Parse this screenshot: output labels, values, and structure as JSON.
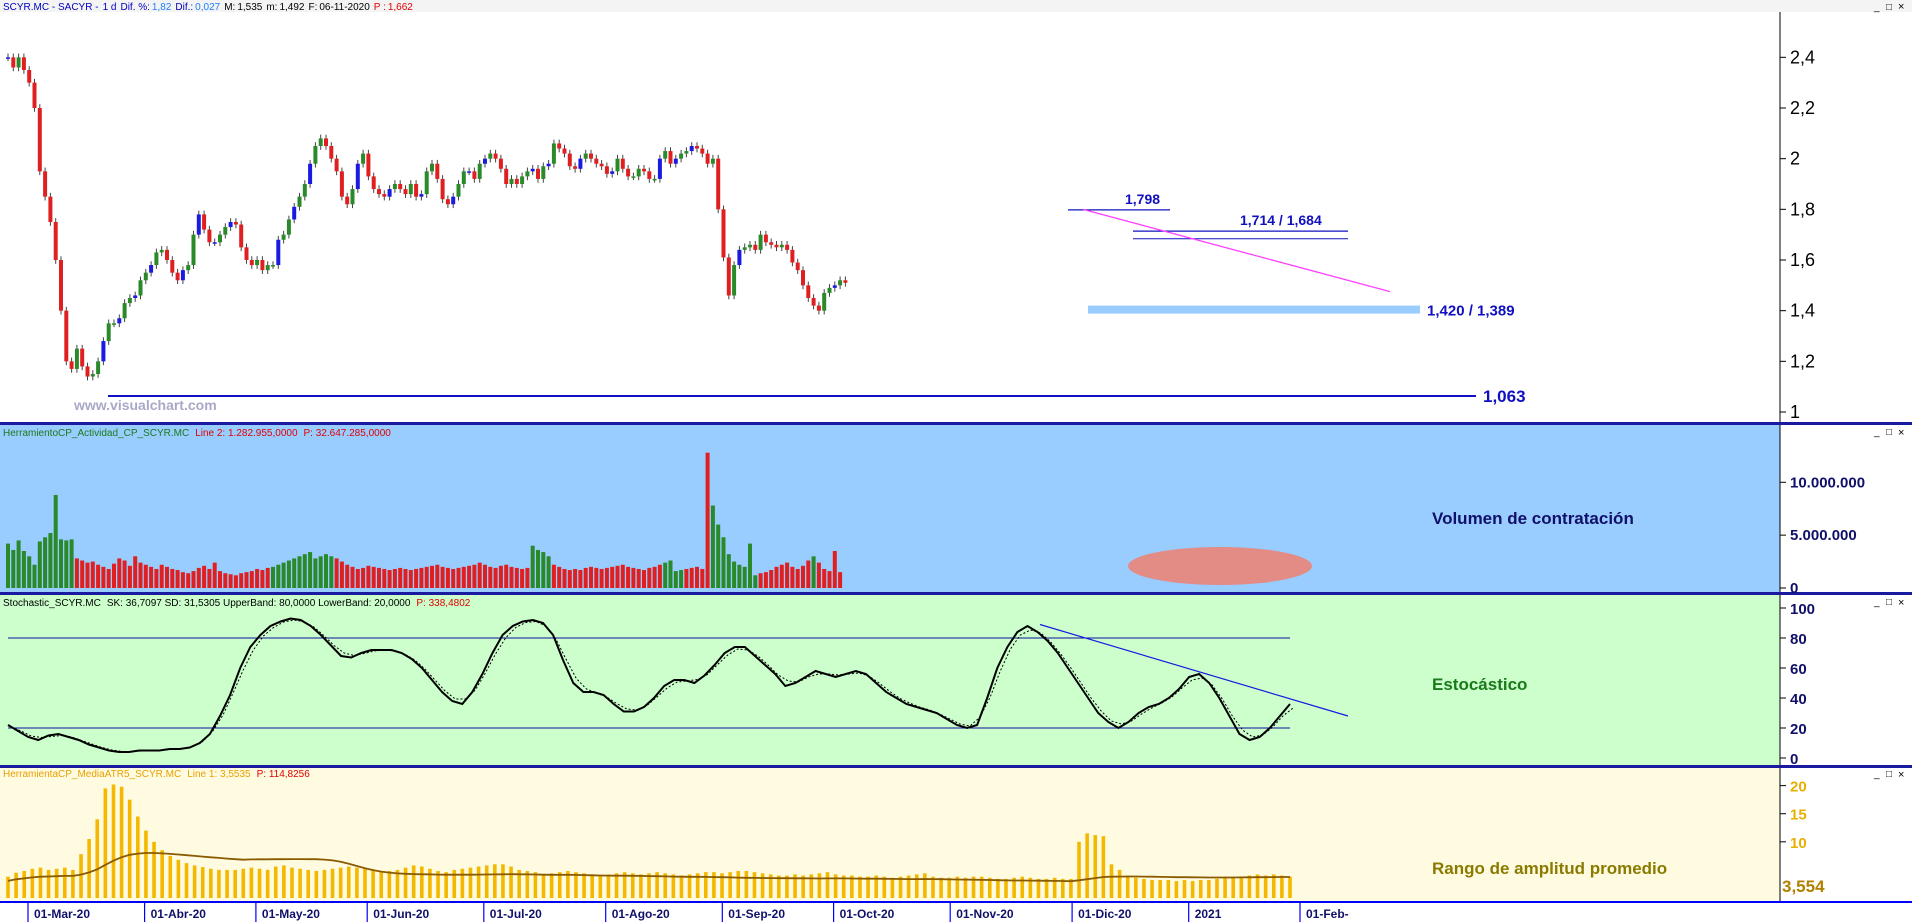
{
  "header": {
    "symbol": "SCYR.MC - SACYR -",
    "timeframe": "1 d",
    "dif_pct_label": "Dif. %:",
    "dif_pct": "1,82",
    "dif_label": "Dif.:",
    "dif": "0,027",
    "max_label": "M:",
    "max": "1,535",
    "min_label": "m:",
    "min": "1,492",
    "date_label": "F:",
    "date": "06-11-2020",
    "price_label": "P :",
    "price": "1,662"
  },
  "watermark": "www.visualchart.com",
  "window_controls": [
    "_",
    "□",
    "×"
  ],
  "colors": {
    "bull_candle": "#2a8a2a",
    "bear_candle": "#e02020",
    "blue_candle": "#1a1ae0",
    "volume_bg": "#99ccff",
    "stoch_bg": "#ccffcc",
    "atr_bg": "#fffbe0",
    "atr_bar": "#f5b800",
    "level_line": "#1010c0",
    "trend_magenta": "#ff40ff",
    "support_zone": "#99ccff"
  },
  "chart_data": [
    {
      "type": "candlestick",
      "title": "SCYR.MC - SACYR - 1 d",
      "ylim": [
        1.0,
        2.5
      ],
      "yticks": [
        "2,4",
        "2,2",
        "2",
        "1,8",
        "1,6",
        "1,4",
        "1,2",
        "1"
      ],
      "yticks_values": [
        2.4,
        2.2,
        2.0,
        1.8,
        1.6,
        1.4,
        1.2,
        1.0
      ],
      "x_tick_labels": [
        "01-Mar-20",
        "01-Abr-20",
        "01-May-20",
        "01-Jun-20",
        "01-Jul-20",
        "01-Ago-20",
        "01-Sep-20",
        "01-Oct-20",
        "01-Nov-20",
        "01-Dic-20",
        "2021",
        "01-Feb-"
      ],
      "x_tick_index": [
        0,
        22,
        43,
        64,
        86,
        109,
        131,
        152,
        174,
        197,
        219,
        240
      ],
      "close_approx": [
        2.4,
        2.36,
        2.4,
        2.35,
        2.3,
        2.2,
        1.95,
        1.85,
        1.75,
        1.6,
        1.4,
        1.2,
        1.17,
        1.25,
        1.18,
        1.14,
        1.15,
        1.2,
        1.28,
        1.35,
        1.35,
        1.37,
        1.43,
        1.45,
        1.46,
        1.52,
        1.55,
        1.58,
        1.63,
        1.64,
        1.6,
        1.55,
        1.52,
        1.56,
        1.58,
        1.7,
        1.78,
        1.72,
        1.67,
        1.67,
        1.7,
        1.73,
        1.75,
        1.74,
        1.65,
        1.6,
        1.58,
        1.6,
        1.56,
        1.58,
        1.58,
        1.68,
        1.7,
        1.76,
        1.81,
        1.85,
        1.9,
        1.98,
        2.05,
        2.08,
        2.05,
        2.0,
        1.95,
        1.85,
        1.82,
        1.88,
        1.98,
        2.02,
        1.93,
        1.88,
        1.86,
        1.85,
        1.88,
        1.9,
        1.88,
        1.86,
        1.9,
        1.85,
        1.86,
        1.95,
        1.98,
        1.92,
        1.84,
        1.82,
        1.85,
        1.9,
        1.95,
        1.95,
        1.92,
        1.98,
        2.0,
        2.02,
        2.0,
        1.96,
        1.9,
        1.92,
        1.9,
        1.93,
        1.95,
        1.96,
        1.92,
        1.97,
        1.98,
        2.06,
        2.04,
        2.02,
        1.97,
        1.96,
        2.0,
        2.02,
        2.0,
        1.98,
        1.97,
        1.94,
        1.95,
        2.0,
        1.96,
        1.93,
        1.93,
        1.96,
        1.95,
        1.92,
        1.92,
        2.0,
        2.03,
        1.98,
        2.0,
        2.02,
        2.03,
        2.05,
        2.04,
        2.02,
        1.98,
        2.0
      ],
      "gap_start_index": 132,
      "close_after_gap": [
        1.8,
        1.61,
        1.46,
        1.58,
        1.64,
        1.65,
        1.66,
        1.64,
        1.7,
        1.67,
        1.66,
        1.65,
        1.66,
        1.64,
        1.59,
        1.56,
        1.5,
        1.45,
        1.42,
        1.4,
        1.47,
        1.49,
        1.5,
        1.52,
        1.51
      ],
      "annotations": [
        {
          "label": "1,798",
          "value": 1.798
        },
        {
          "label": "1,714 / 1,684",
          "value": 1.714
        },
        {
          "label": "1,420 / 1,389",
          "value": 1.42
        },
        {
          "label": "1,063",
          "value": 1.063
        }
      ]
    },
    {
      "type": "bar",
      "name": "HerramientoCP_Actividad_CP_SCYR.MC",
      "legend_text": "Line 2: 1.282.955,0000",
      "legend_price": "P: 32.647.285,0000",
      "label": "Volumen de contratación",
      "ylim": [
        0,
        14000000
      ],
      "yticks": [
        "10.000.000",
        "5.000.000",
        "0"
      ],
      "yticks_values": [
        10000000,
        5000000,
        0
      ],
      "volume_approx": [
        4.2,
        3.6,
        4.5,
        3.5,
        3.0,
        2.2,
        4.4,
        4.8,
        5.2,
        8.8,
        4.6,
        4.5,
        4.6,
        2.8,
        2.6,
        2.4,
        2.5,
        2.2,
        2.0,
        1.8,
        2.3,
        2.8,
        2.6,
        2.1,
        3.0,
        2.4,
        2.2,
        2.0,
        1.8,
        2.2,
        2.0,
        1.8,
        1.7,
        1.5,
        1.4,
        1.6,
        1.9,
        2.1,
        1.8,
        2.4,
        1.6,
        1.4,
        1.3,
        1.2,
        1.4,
        1.5,
        1.6,
        1.8,
        1.7,
        1.9,
        2.0,
        2.2,
        2.4,
        2.6,
        2.8,
        3.0,
        3.2,
        3.4,
        2.8,
        3.0,
        3.2,
        3.0,
        2.8,
        2.5,
        2.2,
        2.0,
        1.8,
        1.9,
        2.1,
        2.0,
        1.9,
        1.8,
        1.7,
        1.8,
        1.9,
        1.8,
        1.7,
        1.8,
        1.9,
        2.0,
        2.1,
        2.2,
        2.0,
        1.9,
        1.8,
        1.9,
        2.0,
        2.1,
        2.2,
        2.4,
        2.2,
        2.0,
        1.9,
        2.1,
        2.2,
        2.0,
        1.9,
        1.8,
        1.9,
        4.0,
        3.6,
        3.4,
        3.0,
        2.2,
        2.0,
        1.8,
        1.7,
        1.8,
        1.7,
        1.9,
        2.0,
        1.9,
        1.8,
        1.9,
        2.0,
        2.1,
        2.2,
        2.0,
        1.9,
        1.8,
        1.7,
        1.9,
        2.0,
        2.2,
        2.4,
        2.6,
        1.6,
        1.7,
        1.8,
        1.9,
        2.0,
        1.8,
        12.8,
        7.8,
        6.0,
        4.8,
        3.2,
        2.5,
        2.2,
        2.0,
        4.2,
        1.2,
        1.4,
        1.5,
        1.7,
        2.0,
        2.2,
        2.4,
        2.0,
        1.8,
        2.1,
        2.6,
        3.0,
        2.4,
        1.8,
        1.6,
        3.5,
        1.5
      ],
      "volume_units": "millions",
      "volume_up": [
        1,
        1,
        1,
        1,
        1,
        1,
        1,
        1,
        1,
        1,
        1,
        1,
        1,
        0,
        0,
        0,
        0,
        0,
        0,
        0,
        0,
        0,
        0,
        0,
        0,
        0,
        0,
        0,
        0,
        0,
        0,
        0,
        0,
        0,
        0,
        0,
        0,
        0,
        0,
        0,
        0,
        0,
        0,
        0,
        0,
        0,
        0,
        0,
        0,
        0,
        1,
        1,
        1,
        1,
        1,
        1,
        1,
        1,
        1,
        1,
        1,
        1,
        0,
        0,
        0,
        0,
        0,
        0,
        0,
        0,
        0,
        0,
        0,
        0,
        0,
        0,
        0,
        0,
        0,
        0,
        0,
        0,
        0,
        0,
        0,
        0,
        0,
        0,
        0,
        0,
        0,
        0,
        0,
        0,
        0,
        0,
        0,
        0,
        0,
        1,
        1,
        1,
        1,
        0,
        0,
        0,
        0,
        0,
        0,
        0,
        0,
        0,
        0,
        0,
        0,
        0,
        0,
        0,
        0,
        0,
        0,
        0,
        0,
        0,
        1,
        1,
        1,
        1,
        0,
        0,
        0,
        0,
        0,
        1,
        1,
        1,
        1,
        1,
        1,
        1,
        1,
        1,
        0,
        0,
        0,
        0,
        0,
        0,
        0,
        0,
        0,
        0,
        1,
        0,
        0,
        0,
        0,
        0
      ]
    },
    {
      "type": "line",
      "name": "Stochastic_SCYR.MC",
      "legend_text": "SK: 36,7097  SD: 31,5305  UpperBand: 80,0000  LowerBand: 20,0000",
      "legend_price": "P: 338,4802",
      "label": "Estocástico",
      "ylim": [
        0,
        100
      ],
      "yticks": [
        "100",
        "80",
        "60",
        "40",
        "20",
        "0"
      ],
      "yticks_values": [
        100,
        80,
        60,
        40,
        20,
        0
      ],
      "bands": [
        80,
        20
      ],
      "sk_approx": [
        22,
        18,
        14,
        12,
        15,
        16,
        14,
        12,
        9,
        7,
        5,
        4,
        4,
        5,
        5,
        5,
        6,
        6,
        7,
        10,
        16,
        28,
        42,
        60,
        74,
        82,
        88,
        91,
        93,
        92,
        88,
        82,
        75,
        68,
        67,
        70,
        72,
        72,
        72,
        70,
        66,
        60,
        52,
        44,
        38,
        36,
        44,
        56,
        70,
        82,
        88,
        91,
        92,
        90,
        82,
        65,
        50,
        44,
        44,
        42,
        36,
        31,
        31,
        34,
        40,
        48,
        52,
        52,
        50,
        55,
        62,
        70,
        74,
        74,
        68,
        62,
        56,
        48,
        50,
        54,
        58,
        56,
        54,
        56,
        58,
        56,
        50,
        44,
        40,
        36,
        34,
        32,
        30,
        26,
        22,
        20,
        22,
        40,
        60,
        74,
        84,
        88,
        84,
        78,
        70,
        60,
        50,
        40,
        30,
        24,
        20,
        24,
        30,
        34,
        36,
        40,
        46,
        54,
        56,
        50,
        40,
        28,
        16,
        12,
        14,
        20,
        28,
        36
      ]
    },
    {
      "type": "bar",
      "name": "HerramientaCP_MediaATR5_SCYR.MC",
      "legend_text": "Line 1: 3,5535",
      "legend_price": "P: 114,8256",
      "label": "Rango de amplitud promedio",
      "last_value_label": "3,554",
      "ylim": [
        0,
        21
      ],
      "yticks": [
        "20",
        "15",
        "10"
      ],
      "yticks_values": [
        20,
        15,
        10
      ],
      "atr_approx": [
        3.8,
        4.5,
        4.8,
        5.2,
        5.4,
        5.0,
        5.2,
        5.4,
        5.0,
        7.8,
        10.5,
        14.0,
        19.5,
        20.2,
        19.8,
        17.5,
        14.5,
        12.0,
        10.0,
        8.5,
        7.5,
        6.8,
        6.2,
        5.8,
        5.5,
        5.2,
        5.0,
        5.0,
        5.0,
        5.2,
        5.4,
        5.2,
        5.0,
        5.6,
        5.8,
        5.4,
        5.2,
        5.0,
        4.8,
        5.0,
        5.2,
        5.4,
        5.6,
        5.4,
        5.2,
        5.0,
        4.6,
        4.8,
        5.0,
        5.4,
        5.8,
        5.6,
        5.2,
        4.8,
        4.6,
        5.0,
        5.2,
        5.4,
        5.6,
        5.8,
        6.0,
        6.0,
        5.6,
        5.0,
        4.8,
        4.6,
        4.2,
        4.4,
        4.6,
        4.8,
        4.6,
        4.4,
        4.2,
        4.0,
        4.2,
        4.4,
        4.6,
        4.4,
        4.2,
        4.4,
        4.6,
        4.4,
        4.2,
        4.0,
        4.2,
        4.4,
        4.6,
        4.6,
        4.4,
        4.6,
        4.8,
        4.8,
        4.6,
        4.4,
        4.2,
        4.0,
        4.0,
        4.2,
        4.0,
        4.2,
        4.4,
        4.6,
        4.2,
        4.0,
        4.0,
        3.8,
        3.8,
        4.0,
        3.8,
        3.6,
        3.8,
        4.0,
        4.2,
        4.4,
        3.8,
        3.6,
        3.6,
        3.8,
        3.6,
        3.8,
        3.8,
        3.6,
        3.4,
        3.4,
        3.6,
        3.8,
        3.6,
        3.4,
        3.4,
        3.6,
        3.4,
        3.4,
        10.0,
        11.5,
        11.2,
        11.0,
        6.0,
        5.0,
        4.0,
        3.6,
        3.4,
        3.2,
        3.2,
        3.2,
        3.0,
        3.2,
        3.0,
        3.2,
        3.2,
        3.4,
        3.8,
        3.8,
        3.8,
        4.0,
        4.2,
        4.0,
        4.2,
        4.0,
        3.8
      ]
    }
  ]
}
